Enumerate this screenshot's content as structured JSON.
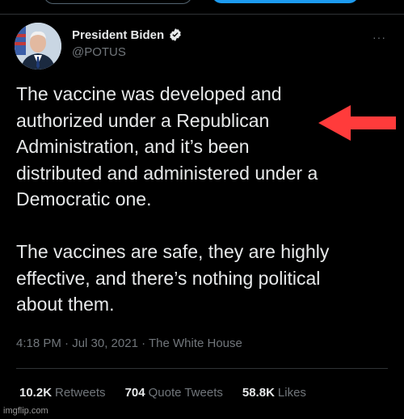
{
  "tweet": {
    "author_name": "President Biden",
    "author_handle": "@POTUS",
    "more_label": "···",
    "text": "The vaccine was developed and\nauthorized under a Republican\nAdministration, and it’s been\ndistributed and administered under a\nDemocratic one.\n\nThe vaccines are safe, they are highly\neffective, and there’s nothing political\nabout them.",
    "meta": "4:18 PM · Jul 30, 2021 · The White House"
  },
  "stats": [
    {
      "count": "10.2K",
      "label": "Retweets"
    },
    {
      "count": "704",
      "label": "Quote Tweets"
    },
    {
      "count": "58.8K",
      "label": "Likes"
    }
  ],
  "watermark": "imgflip.com",
  "colors": {
    "background": "#000000",
    "text": "#e7e9ea",
    "secondary_text": "#71767b",
    "arrow": "#ff3b3b",
    "verified": "#e7e9ea"
  },
  "icons": {
    "verified": "verified-badge-icon",
    "more": "more-options-icon",
    "arrow": "red-arrow-icon"
  }
}
